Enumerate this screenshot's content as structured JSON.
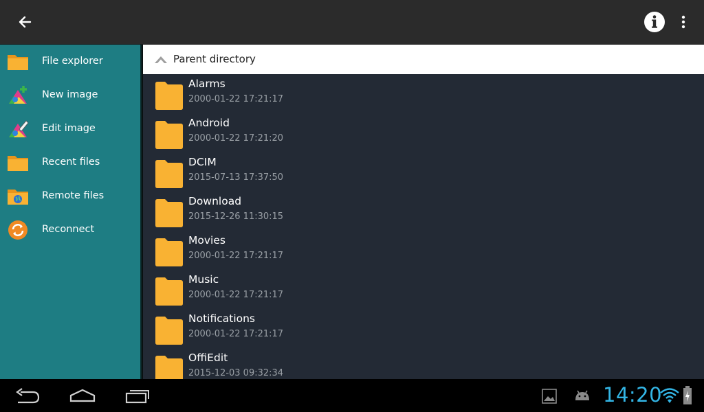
{
  "sidebar": {
    "items": [
      {
        "label": "File explorer",
        "icon": "folder-icon"
      },
      {
        "label": "New image",
        "icon": "new-image-icon"
      },
      {
        "label": "Edit image",
        "icon": "edit-image-icon"
      },
      {
        "label": "Recent files",
        "icon": "folder-icon"
      },
      {
        "label": "Remote files",
        "icon": "remote-folder-icon"
      },
      {
        "label": "Reconnect",
        "icon": "reconnect-icon"
      }
    ]
  },
  "parent_directory": {
    "label": "Parent directory"
  },
  "files": [
    {
      "name": "Alarms",
      "date": "2000-01-22 17:21:17"
    },
    {
      "name": "Android",
      "date": "2000-01-22 17:21:20"
    },
    {
      "name": "DCIM",
      "date": "2015-07-13 17:37:50"
    },
    {
      "name": "Download",
      "date": "2015-12-26 11:30:15"
    },
    {
      "name": "Movies",
      "date": "2000-01-22 17:21:17"
    },
    {
      "name": "Music",
      "date": "2000-01-22 17:21:17"
    },
    {
      "name": "Notifications",
      "date": "2000-01-22 17:21:17"
    },
    {
      "name": "OffiEdit",
      "date": "2015-12-03 09:32:34"
    }
  ],
  "status": {
    "clock": "14:20"
  },
  "colors": {
    "sidebar": "#1e7d83",
    "list_background": "#232a35",
    "folder": "#f9b233",
    "clock": "#33b5e5"
  }
}
